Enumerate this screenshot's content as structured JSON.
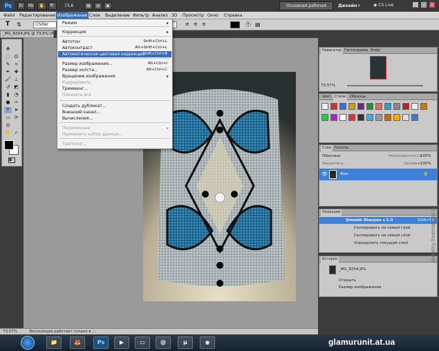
{
  "app": {
    "logo": "Ps",
    "workspace_button": "Основная рабочая среда",
    "design_label": "Дизайн",
    "cs_live": "CS Live"
  },
  "menubar": {
    "items": [
      "Файл",
      "Редактирование",
      "Изображение",
      "Слои",
      "Выделение",
      "Фильтр",
      "Анализ",
      "3D",
      "Просмотр",
      "Окно",
      "Справка"
    ],
    "active_index": 2
  },
  "toolbar": {
    "zoom": "73,6",
    "font_name": "Chiller"
  },
  "document": {
    "tab_title": "_MG_8254.JPG @ 73,6% (Фон..."
  },
  "image_menu": {
    "items": [
      {
        "label": "Режим",
        "shortcut": "",
        "submenu": true,
        "disabled": false,
        "highlighted": false
      },
      {
        "label": "Коррекция",
        "shortcut": "",
        "submenu": true,
        "disabled": false,
        "highlighted": false
      },
      {
        "label": "Автотон",
        "shortcut": "Shift+Ctrl+L",
        "submenu": false,
        "disabled": false,
        "highlighted": false
      },
      {
        "label": "Автоконтраст",
        "shortcut": "Alt+Shift+Ctrl+L",
        "submenu": false,
        "disabled": false,
        "highlighted": false
      },
      {
        "label": "Автоматическая цветовая коррекция",
        "shortcut": "Shift+Ctrl+B",
        "submenu": false,
        "disabled": false,
        "highlighted": true
      },
      {
        "label": "Размер изображения...",
        "shortcut": "Alt+Ctrl+I",
        "submenu": false,
        "disabled": false,
        "highlighted": false
      },
      {
        "label": "Размер холста...",
        "shortcut": "Alt+Ctrl+C",
        "submenu": false,
        "disabled": false,
        "highlighted": false
      },
      {
        "label": "Вращение изображения",
        "shortcut": "",
        "submenu": true,
        "disabled": false,
        "highlighted": false
      },
      {
        "label": "Кадрировать",
        "shortcut": "",
        "submenu": false,
        "disabled": true,
        "highlighted": false
      },
      {
        "label": "Тримминг...",
        "shortcut": "",
        "submenu": false,
        "disabled": false,
        "highlighted": false
      },
      {
        "label": "Показать все",
        "shortcut": "",
        "submenu": false,
        "disabled": true,
        "highlighted": false
      },
      {
        "label": "Создать дубликат...",
        "shortcut": "",
        "submenu": false,
        "disabled": false,
        "highlighted": false
      },
      {
        "label": "Внешний канал...",
        "shortcut": "",
        "submenu": false,
        "disabled": false,
        "highlighted": false
      },
      {
        "label": "Вычисления...",
        "shortcut": "",
        "submenu": false,
        "disabled": false,
        "highlighted": false
      },
      {
        "label": "Переменные",
        "shortcut": "",
        "submenu": true,
        "disabled": true,
        "highlighted": false
      },
      {
        "label": "Применить набор данных...",
        "shortcut": "",
        "submenu": false,
        "disabled": true,
        "highlighted": false
      },
      {
        "label": "Треппинг...",
        "shortcut": "",
        "submenu": false,
        "disabled": true,
        "highlighted": false
      }
    ]
  },
  "navigator": {
    "tabs": [
      "Навигатор",
      "Гистограмма",
      "Инфо"
    ],
    "zoom": "73,57%"
  },
  "styles": {
    "tabs": [
      "Цвет",
      "Стили",
      "Образцы"
    ]
  },
  "layers": {
    "tabs": [
      "Слои",
      "Каналы"
    ],
    "blend_mode": "Обычные",
    "opacity_label": "Непрозрачность:",
    "opacity": "100%",
    "fill_label": "Заливка:",
    "fill": "100%",
    "lock_label": "Закрепить:",
    "layer_name": "Фон"
  },
  "actions": {
    "tab": "Операции",
    "items": [
      "Smooth Sharpen v.1.0",
      "Скопировать на новый слой",
      "Скопировать на новый слой",
      "Определить текущий слой"
    ],
    "shortcut": "Shift+F4"
  },
  "history": {
    "tab": "История",
    "snapshot": "_MG_8254.JPG",
    "items": [
      "Открыть",
      "Размер изображения"
    ]
  },
  "status": {
    "zoom": "73,57%",
    "text": "Экспозиция работает только в ..."
  },
  "watermark": {
    "main": "glamurunit.at.ua",
    "side": "Jewelry.livemaster.ru"
  }
}
